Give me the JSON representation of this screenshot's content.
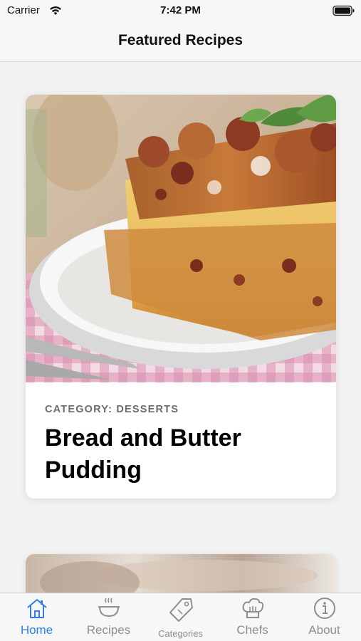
{
  "status_bar": {
    "carrier": "Carrier",
    "time": "7:42 PM"
  },
  "nav": {
    "title": "Featured Recipes"
  },
  "cards": [
    {
      "category": "CATEGORY: DESSERTS",
      "title": "Bread and Butter Pudding",
      "image": "bread-and-butter-pudding-photo"
    },
    {
      "image": "recipe-photo-partial"
    }
  ],
  "tabs": [
    {
      "label": "Home",
      "icon": "home-icon",
      "active": true
    },
    {
      "label": "Recipes",
      "icon": "bowl-icon",
      "active": false
    },
    {
      "label": "Categories",
      "icon": "tag-icon",
      "active": false
    },
    {
      "label": "Chefs",
      "icon": "chef-hat-icon",
      "active": false
    },
    {
      "label": "About",
      "icon": "info-icon",
      "active": false
    }
  ],
  "colors": {
    "accent": "#2f7fe4",
    "inactive": "#8e8e8e",
    "background": "#f2f2f2"
  }
}
